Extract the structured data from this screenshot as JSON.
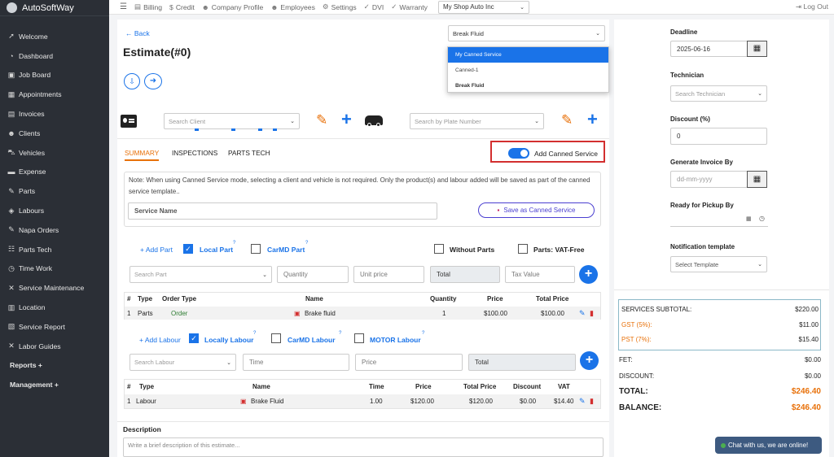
{
  "brand": "AutoSoftWay",
  "sidebar": {
    "items": [
      {
        "label": "Welcome",
        "icon": "rocket-icon"
      },
      {
        "label": "Dashboard",
        "icon": "gauge-icon"
      },
      {
        "label": "Job Board",
        "icon": "briefcase-icon"
      },
      {
        "label": "Appointments",
        "icon": "calendar-icon"
      },
      {
        "label": "Invoices",
        "icon": "invoice-icon"
      },
      {
        "label": "Clients",
        "icon": "users-icon"
      },
      {
        "label": "Vehicles",
        "icon": "car-icon"
      },
      {
        "label": "Expense",
        "icon": "money-icon"
      },
      {
        "label": "Parts",
        "icon": "wrench-icon"
      },
      {
        "label": "Labours",
        "icon": "layers-icon"
      },
      {
        "label": "Napa Orders",
        "icon": "wrench-icon"
      },
      {
        "label": "Parts Tech",
        "icon": "sitemap-icon"
      },
      {
        "label": "Time Work",
        "icon": "clock-icon"
      },
      {
        "label": "Service Maintenance",
        "icon": "tools-icon"
      },
      {
        "label": "Location",
        "icon": "map-icon"
      },
      {
        "label": "Service Report",
        "icon": "report-icon"
      },
      {
        "label": "Labor Guides",
        "icon": "tools-icon"
      }
    ],
    "reports": "Reports +",
    "management": "Management +"
  },
  "topbar": {
    "items": [
      {
        "label": "Billing",
        "icon": "billing-icon"
      },
      {
        "label": "Credit",
        "icon": "dollar-icon"
      },
      {
        "label": "Company Profile",
        "icon": "user-icon"
      },
      {
        "label": "Employees",
        "icon": "users-icon"
      },
      {
        "label": "Settings",
        "icon": "gear-icon"
      },
      {
        "label": "DVI",
        "icon": "check-icon"
      },
      {
        "label": "Warranty",
        "icon": "tag-icon"
      }
    ],
    "shop": "My Shop Auto Inc",
    "logout": "Log Out"
  },
  "estimate": {
    "back": "Back",
    "title": "Estimate(#0)",
    "search_client_placeholder": "Search Client",
    "search_plate_placeholder": "Search by Plate Number"
  },
  "canned": {
    "selected": "Break Fluid",
    "options": [
      "My Canned Service",
      "Canned-1",
      "Break Fluid"
    ],
    "toggle_label": "Add Canned Service",
    "note": "Note: When using Canned Service mode, selecting a client and vehicle is not required. Only the product(s) and labour added will be saved as part of the canned service template..",
    "service_name_placeholder": "Service Name",
    "save_button": "Save as Canned Service"
  },
  "tabs": [
    "SUMMARY",
    "INSPECTIONS",
    "PARTS TECH"
  ],
  "parts": {
    "add_part": "+ Add Part",
    "local_part": "Local Part",
    "carmd_part": "CarMD Part",
    "without_parts": "Without Parts",
    "vat_free": "Parts: VAT-Free",
    "search_placeholder": "Search Part",
    "quantity_placeholder": "Quantity",
    "unit_price_placeholder": "Unit price",
    "total_placeholder": "Total",
    "tax_placeholder": "Tax Value",
    "headers": [
      "#",
      "Type",
      "Order Type",
      "Name",
      "Quantity",
      "Price",
      "Total Price"
    ],
    "rows": [
      {
        "num": "1",
        "type": "Parts",
        "order_type": "Order",
        "name": "Brake fluid",
        "quantity": "1",
        "price": "$100.00",
        "total": "$100.00"
      }
    ]
  },
  "labour": {
    "add_labour": "+ Add Labour",
    "locally": "Locally Labour",
    "carmd": "CarMD Labour",
    "motor": "MOTOR Labour",
    "search_placeholder": "Search Labour",
    "time_placeholder": "Time",
    "price_placeholder": "Price",
    "total_placeholder": "Total",
    "headers": [
      "#",
      "Type",
      "Name",
      "Time",
      "Price",
      "Total Price",
      "Discount",
      "VAT"
    ],
    "rows": [
      {
        "num": "1",
        "type": "Labour",
        "name": "Brake Fluid",
        "time": "1.00",
        "price": "$120.00",
        "total": "$120.00",
        "discount": "$0.00",
        "vat": "$14.40"
      }
    ]
  },
  "description": {
    "label": "Description",
    "placeholder": "Write a brief description of this estimate..."
  },
  "right": {
    "deadline_label": "Deadline",
    "deadline_value": "2025-06-16",
    "technician_label": "Technician",
    "technician_placeholder": "Search Technician",
    "discount_label": "Discount (%)",
    "discount_value": "0",
    "invoice_by_label": "Generate Invoice By",
    "invoice_by_placeholder": "dd-mm-yyyy",
    "pickup_label": "Ready for Pickup By",
    "notification_label": "Notification template",
    "notification_placeholder": "Select Template"
  },
  "summary": {
    "services_subtotal_label": "SERVICES SUBTOTAL:",
    "services_subtotal": "$220.00",
    "gst_label": "GST (5%):",
    "gst": "$11.00",
    "pst_label": "PST (7%):",
    "pst": "$15.40",
    "fet_label": "FET:",
    "fet": "$0.00",
    "discount_label": "DISCOUNT:",
    "discount": "$0.00",
    "total_label": "TOTAL:",
    "total": "$246.40",
    "balance_label": "BALANCE:",
    "balance": "$246.40"
  },
  "chat": "Chat with us, we are online!",
  "colors": {
    "sidebar": "#2b2f36",
    "accent": "#1a73e8",
    "orange": "#e8710a",
    "highlight_border": "#d32f2f"
  }
}
